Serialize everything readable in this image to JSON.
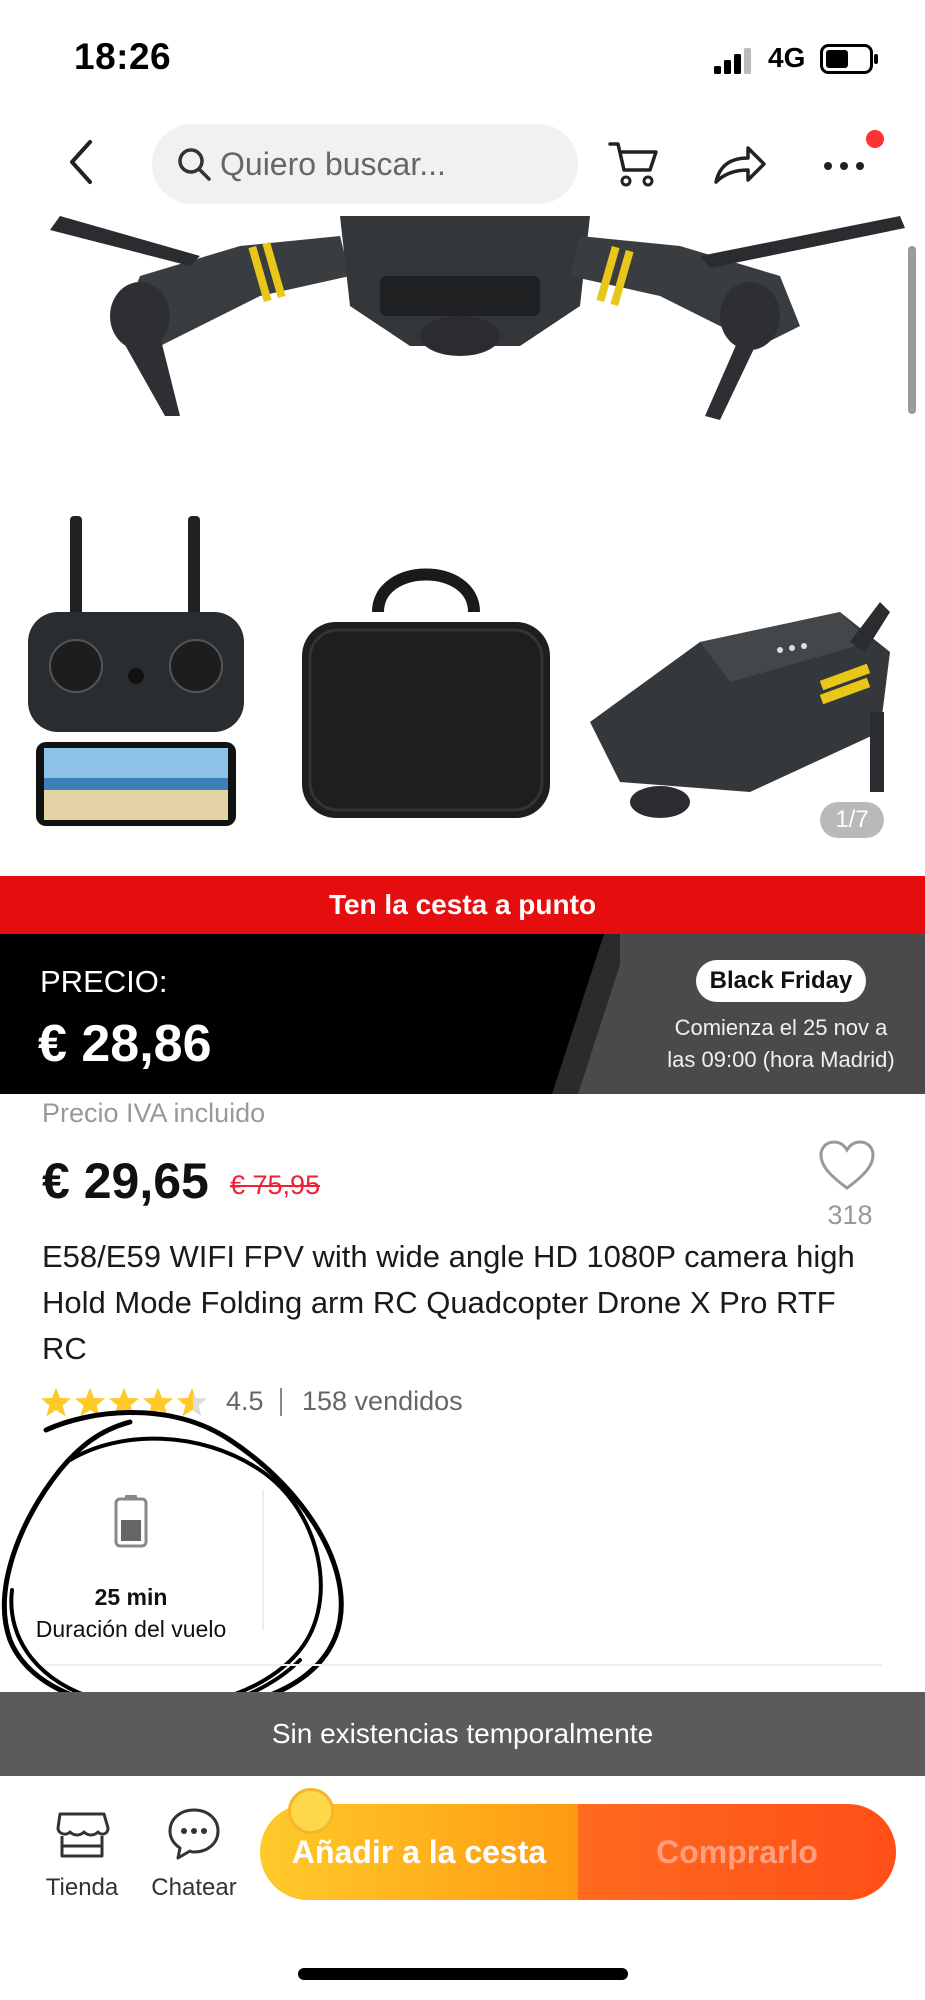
{
  "status_bar": {
    "time": "18:26",
    "network": "4G"
  },
  "nav": {
    "search_placeholder": "Quiero buscar..."
  },
  "gallery": {
    "counter": "1/7"
  },
  "promo_banner": "Ten la cesta a punto",
  "price_band": {
    "label": "PRECIO:",
    "price": "€ 28,86",
    "badge": "Black Friday",
    "date_line1": "Comienza el 25 nov a",
    "date_line2": "las 09:00 (hora Madrid)"
  },
  "product": {
    "vat_note": "Precio IVA incluido",
    "current_price": "€ 29,65",
    "old_price": "€ 75,95",
    "wishlist_count": "318",
    "title": "E58/E59 WIFI FPV with wide angle HD 1080P camera high Hold Mode Folding arm RC Quadcopter Drone X Pro RTF RC",
    "rating": "4.5",
    "rating_fraction": 0.9,
    "sold": "158 vendidos"
  },
  "spec": {
    "value": "25 min",
    "label": "Duración del vuelo"
  },
  "stock_status": "Sin existencias temporalmente",
  "bottom_bar": {
    "store_label": "Tienda",
    "chat_label": "Chatear",
    "add_to_cart": "Añadir a la cesta",
    "buy_now": "Comprarlo"
  },
  "colors": {
    "promo_red": "#e50d0d",
    "add_cart_orange": "#ffae1a",
    "buy_orange": "#ff4f18",
    "old_price_red": "#ee2233",
    "star_yellow": "#ffc928"
  }
}
